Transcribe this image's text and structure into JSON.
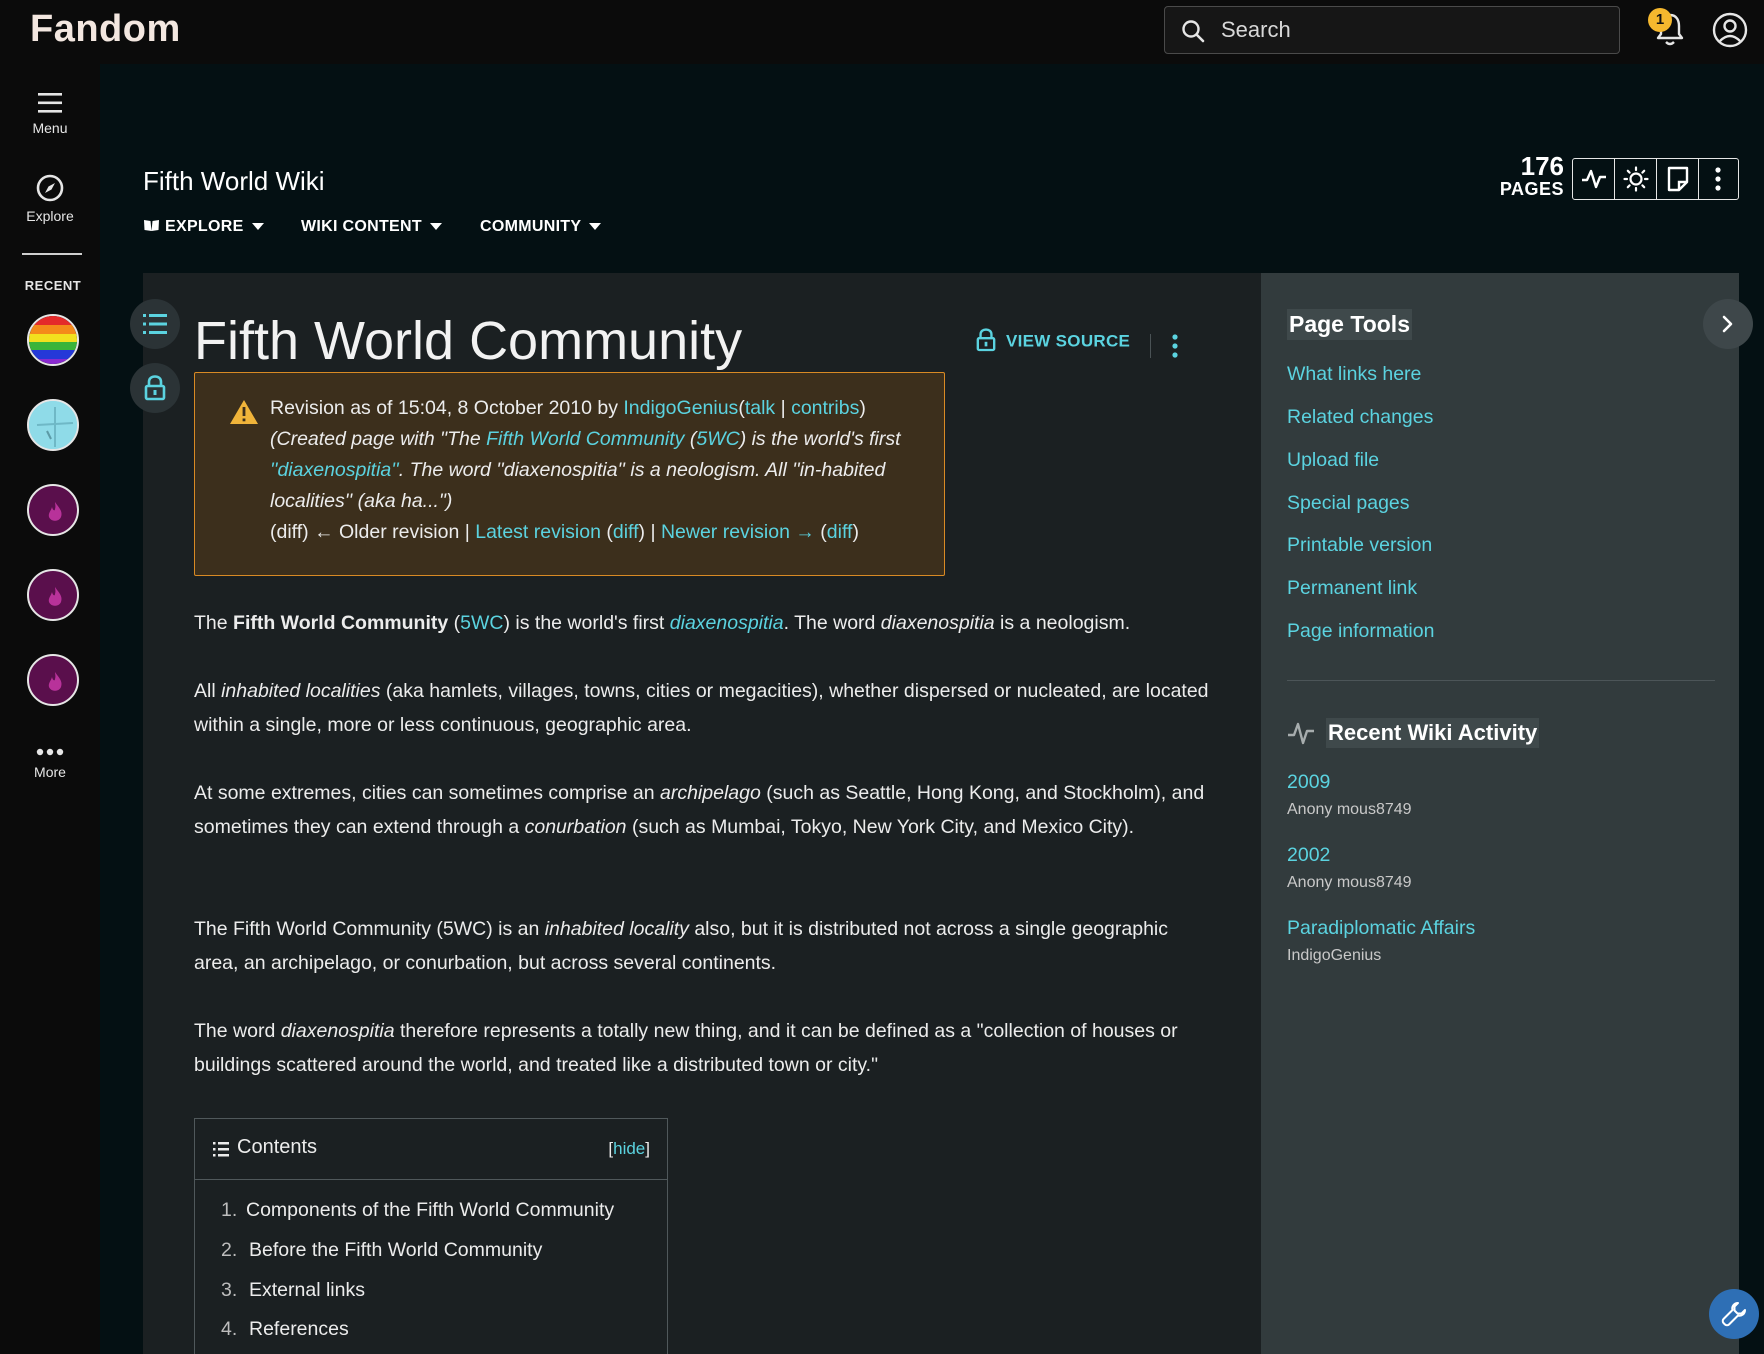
{
  "topbar": {
    "logo": "Fandom",
    "search_placeholder": "Search",
    "notification_count": "1"
  },
  "rail": {
    "menu_label": "Menu",
    "explore_label": "Explore",
    "recent_label": "RECENT",
    "more_label": "More"
  },
  "wiki": {
    "title": "Fifth World Wiki",
    "nav": [
      "EXPLORE",
      "WIKI CONTENT",
      "COMMUNITY"
    ],
    "pages_count": "176",
    "pages_label": "PAGES"
  },
  "article": {
    "title": "Fifth World Community",
    "view_source": "VIEW SOURCE",
    "revision": {
      "prefix": "Revision as of 15:04, 8 October 2010 by ",
      "user": "IndigoGenius",
      "talk": "talk",
      "contribs": "contribs",
      "summary_1": "(Created page with \"The ",
      "summary_link_1": "Fifth World Community",
      "summary_2": " (",
      "summary_link_2": "5WC",
      "summary_3": ") is the world's first ",
      "summary_link_3": "''diaxenospitia''",
      "summary_4": ". The word ''diaxenospitia'' is a neologism. All ''in-habited localities'' (aka ha...\")",
      "diff": "diff",
      "older": "← Older revision",
      "latest": "Latest revision",
      "newer": "Newer revision →"
    },
    "paragraphs": {
      "p1_a": "The ",
      "p1_bold": "Fifth World Community",
      "p1_b": " (",
      "p1_link": "5WC",
      "p1_c": ") is the world's first ",
      "p1_link2": "diaxenospitia",
      "p1_d": ". The word ",
      "p1_i": "diaxenospitia",
      "p1_e": " is a neologism.",
      "p2_a": "All ",
      "p2_i": "inhabited localities",
      "p2_b": " (aka hamlets, villages, towns, cities or megacities), whether dispersed or nucleated, are located within a single, more or less continuous, geographic area.",
      "p3_a": "At some extremes, cities can sometimes comprise an ",
      "p3_i": "archipelago",
      "p3_b": " (such as Seattle, Hong Kong, and Stockholm), and sometimes they can extend through a ",
      "p3_i2": "conurbation",
      "p3_c": " (such as Mumbai, Tokyo, New York City, and Mexico City).",
      "p4_a": "The Fifth World Community (5WC) is an ",
      "p4_i": "inhabited locality",
      "p4_b": " also, but it is distributed not across a single geographic area, an archipelago, or conurbation, but across several continents.",
      "p5_a": "The word ",
      "p5_i": "diaxenospitia",
      "p5_b": " therefore represents a totally new thing, and it can be defined as a \"collection of houses or buildings scattered around the world, and treated like a distributed town or city.\""
    },
    "toc": {
      "title": "Contents",
      "hide": "hide",
      "items": [
        {
          "num": "1.",
          "label": "Components of the Fifth World Community"
        },
        {
          "num": "2.",
          "label": "Before the Fifth World Community"
        },
        {
          "num": "3.",
          "label": "External links"
        },
        {
          "num": "4.",
          "label": "References"
        }
      ]
    }
  },
  "page_tools": {
    "title": "Page Tools",
    "links": [
      "What links here",
      "Related changes",
      "Upload file",
      "Special pages",
      "Printable version",
      "Permanent link",
      "Page information"
    ]
  },
  "recent_activity": {
    "title": "Recent Wiki Activity",
    "items": [
      {
        "page": "2009",
        "user": "Anony mous8749"
      },
      {
        "page": "2002",
        "user": "Anony mous8749"
      },
      {
        "page": "Paradiplomatic Affairs",
        "user": "IndigoGenius"
      }
    ]
  },
  "colors": {
    "link": "#5bd3e0",
    "brand_flame": "#fa005a",
    "warning_border": "#d98a24",
    "notification_badge": "#f5b82e"
  }
}
